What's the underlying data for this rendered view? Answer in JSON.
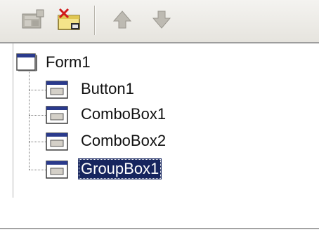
{
  "toolbar": {
    "buttons": [
      {
        "icon": "component-palette-icon",
        "enabled": false
      },
      {
        "icon": "delete-component-icon",
        "enabled": true
      },
      {
        "icon": "move-up-arrow-icon",
        "enabled": false
      },
      {
        "icon": "move-down-arrow-icon",
        "enabled": false
      }
    ]
  },
  "tree": {
    "root": {
      "label": "Form1",
      "icon": "form-icon"
    },
    "children": [
      {
        "label": "Button1",
        "icon": "component-icon",
        "selected": false
      },
      {
        "label": "ComboBox1",
        "icon": "component-icon",
        "selected": false
      },
      {
        "label": "ComboBox2",
        "icon": "component-icon",
        "selected": false
      },
      {
        "label": "GroupBox1",
        "icon": "component-icon",
        "selected": true
      }
    ]
  },
  "colors": {
    "selection_background": "#16255e",
    "selection_text": "#ffffff",
    "icon_title_bar": "#2a3a8c"
  }
}
